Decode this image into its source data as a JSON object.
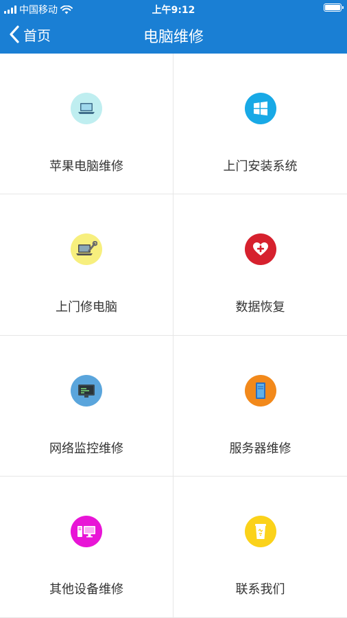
{
  "status_bar": {
    "carrier": "中国移动",
    "time": "上午9:12"
  },
  "nav": {
    "back_label": "首页",
    "title": "电脑维修"
  },
  "services": [
    {
      "label": "苹果电脑维修",
      "icon": "laptop-icon",
      "color": "#bfeef0"
    },
    {
      "label": "上门安装系统",
      "icon": "windows-icon",
      "color": "#18a9e6"
    },
    {
      "label": "上门修电脑",
      "icon": "laptop-repair-icon",
      "color": "#f7ef7e"
    },
    {
      "label": "数据恢复",
      "icon": "heart-plus-icon",
      "color": "#d6212e"
    },
    {
      "label": "网络监控维修",
      "icon": "monitor-icon",
      "color": "#5aa5dc"
    },
    {
      "label": "服务器维修",
      "icon": "server-icon",
      "color": "#f2891b"
    },
    {
      "label": "其他设备维修",
      "icon": "desktop-computer-icon",
      "color": "#e815d6"
    },
    {
      "label": "联系我们",
      "icon": "contact-cup-icon",
      "color": "#fbd21a"
    }
  ]
}
